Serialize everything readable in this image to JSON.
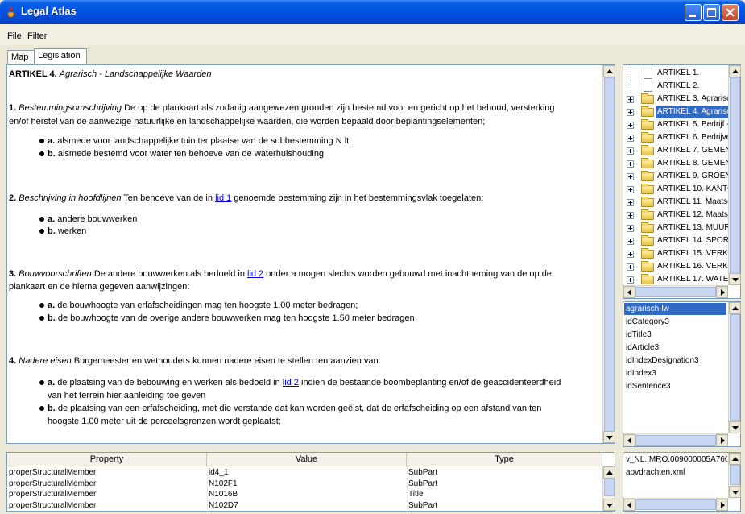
{
  "window": {
    "title": "Legal Atlas"
  },
  "menu": {
    "file": "File",
    "filter": "Filter"
  },
  "tabs": {
    "map": "Map",
    "legislation": "Legislation"
  },
  "article": {
    "heading_bold": "ARTIKEL 4.",
    "heading_italic": "Agrarisch - Landschappelijke Waarden",
    "s1": {
      "num": "1.",
      "title": "Bestemmingsomschrijving",
      "text_line1": "De op de plankaart als zodanig aangewezen gronden zijn bestemd voor en gericht op het behoud, versterking",
      "text_line2": "en/of herstel van de aanwezige natuurlijke en landschappelijke waarden, die worden bepaald door beplantingselementen;",
      "items": [
        {
          "label": "a.",
          "text": "alsmede voor landschappelijke tuin ter plaatse van de subbestemming N lt."
        },
        {
          "label": "b.",
          "text": "alsmede bestemd voor water ten behoeve van de waterhuishouding"
        }
      ]
    },
    "s2": {
      "num": "2.",
      "title": "Beschrijving in hoofdlijnen",
      "text_before": "Ten behoeve van de in",
      "link": "lid 1",
      "text_after": "genoemde bestemming zijn in het bestemmingsvlak toegelaten:",
      "items": [
        {
          "label": "a.",
          "text": "andere bouwwerken"
        },
        {
          "label": "b.",
          "text": "werken"
        }
      ]
    },
    "s3": {
      "num": "3.",
      "title": "Bouwvoorschriften",
      "text_before": "De andere bouwwerken als bedoeld in",
      "link": "lid 2",
      "text_after": "onder a mogen slechts worden gebouwd met inachtneming van de op de",
      "text_line2": "plankaart en de hierna gegeven aanwijzingen:",
      "items": [
        {
          "label": "a.",
          "text": "de bouwhoogte van erfafscheidingen mag ten hoogste 1.00 meter bedragen;"
        },
        {
          "label": "b.",
          "text": "de bouwhoogte van de overige andere bouwwerken mag ten hoogste 1.50 meter bedragen"
        }
      ]
    },
    "s4": {
      "num": "4.",
      "title": "Nadere eisen",
      "text": "Burgemeester en wethouders kunnen nadere eisen te stellen ten aanzien van:",
      "item_a": {
        "label": "a.",
        "text_before": "de plaatsing van de bebouwing en werken als bedoeld in",
        "link": "lid 2",
        "text_after": "indien de bestaande boombeplanting en/of de geaccidenteerdheid",
        "line2": "van het terrein hier aanleiding toe geven"
      },
      "item_b": {
        "label": "b.",
        "line1": "de plaatsing van een erfafscheiding, met die verstande dat kan worden geëist, dat de erfafscheiding op een afstand van ten",
        "line2": "hoogste 1.00 meter uit de perceelsgrenzen wordt geplaatst;"
      }
    }
  },
  "properties": {
    "headers": [
      "Property",
      "Value",
      "Type"
    ],
    "rows": [
      [
        "properStructuralMember",
        "id4_1",
        "SubPart"
      ],
      [
        "properStructuralMember",
        "N102F1",
        "SubPart"
      ],
      [
        "properStructuralMember",
        "N1016B",
        "Title"
      ],
      [
        "properStructuralMember",
        "N102D7",
        "SubPart"
      ]
    ]
  },
  "tree": {
    "items": [
      {
        "label": "ARTIKEL 1.",
        "kind": "file"
      },
      {
        "label": "ARTIKEL 2.",
        "kind": "file"
      },
      {
        "label": "ARTIKEL 3. Agrarisc",
        "kind": "folder"
      },
      {
        "label": "ARTIKEL 4. Agrarisc",
        "kind": "folder",
        "selected": true
      },
      {
        "label": "ARTIKEL 5. Bedrijf -",
        "kind": "folder"
      },
      {
        "label": "ARTIKEL 6. Bedrijve",
        "kind": "folder"
      },
      {
        "label": "ARTIKEL 7. GEMENG",
        "kind": "folder"
      },
      {
        "label": "ARTIKEL 8. GEMENG",
        "kind": "folder"
      },
      {
        "label": "ARTIKEL 9. GROEN",
        "kind": "folder"
      },
      {
        "label": "ARTIKEL 10. KANTO",
        "kind": "folder"
      },
      {
        "label": "ARTIKEL 11. Maatsc",
        "kind": "folder"
      },
      {
        "label": "ARTIKEL 12. Maatsc",
        "kind": "folder"
      },
      {
        "label": "ARTIKEL 13. MUUR",
        "kind": "folder"
      },
      {
        "label": "ARTIKEL 14. SPORT",
        "kind": "folder"
      },
      {
        "label": "ARTIKEL 15. VERKE",
        "kind": "folder"
      },
      {
        "label": "ARTIKEL 16. VERKE",
        "kind": "folder"
      },
      {
        "label": "ARTIKEL 17. WATEI",
        "kind": "folder"
      }
    ]
  },
  "list": {
    "items": [
      "agrarisch-lw",
      "idCategory3",
      "idTitle3",
      "idArticle3",
      "idIndexDesignation3",
      "idIndex3",
      "idSentence3"
    ]
  },
  "files": {
    "items": [
      "v_NL.IMRO.009000005A760",
      "apvdrachten.xml"
    ]
  },
  "colors": {
    "selection": "#316ac5",
    "titlebar": "#0054e3",
    "link": "#0000ee"
  }
}
